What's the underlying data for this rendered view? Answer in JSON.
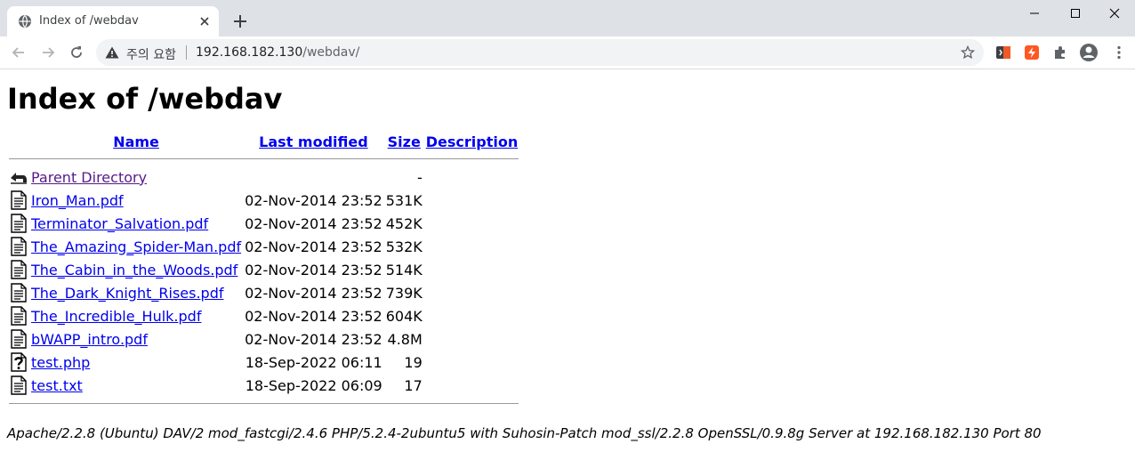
{
  "browser": {
    "tab_title": "Index of /webdav",
    "warning_text": "주의 요함",
    "url_host": "192.168.182.130",
    "url_path": "/webdav/"
  },
  "page": {
    "heading": "Index of /webdav",
    "columns": {
      "name": "Name",
      "modified": "Last modified",
      "size": "Size",
      "description": "Description"
    },
    "parent": {
      "name": "Parent Directory",
      "size": "-"
    },
    "files": [
      {
        "name": "Iron_Man.pdf",
        "modified": "02-Nov-2014 23:52",
        "size": "531K",
        "icon": "document-icon"
      },
      {
        "name": "Terminator_Salvation.pdf",
        "modified": "02-Nov-2014 23:52",
        "size": "452K",
        "icon": "document-icon"
      },
      {
        "name": "The_Amazing_Spider-Man.pdf",
        "modified": "02-Nov-2014 23:52",
        "size": "532K",
        "icon": "document-icon"
      },
      {
        "name": "The_Cabin_in_the_Woods.pdf",
        "modified": "02-Nov-2014 23:52",
        "size": "514K",
        "icon": "document-icon"
      },
      {
        "name": "The_Dark_Knight_Rises.pdf",
        "modified": "02-Nov-2014 23:52",
        "size": "739K",
        "icon": "document-icon"
      },
      {
        "name": "The_Incredible_Hulk.pdf",
        "modified": "02-Nov-2014 23:52",
        "size": "604K",
        "icon": "document-icon"
      },
      {
        "name": "bWAPP_intro.pdf",
        "modified": "02-Nov-2014 23:52",
        "size": "4.8M",
        "icon": "document-icon"
      },
      {
        "name": "test.php",
        "modified": "18-Sep-2022 06:11",
        "size": "19",
        "icon": "unknown-file-icon"
      },
      {
        "name": "test.txt",
        "modified": "18-Sep-2022 06:09",
        "size": "17",
        "icon": "document-icon"
      }
    ],
    "footer": "Apache/2.2.8 (Ubuntu) DAV/2 mod_fastcgi/2.4.6 PHP/5.2.4-2ubuntu5 with Suhosin-Patch mod_ssl/2.2.8 OpenSSL/0.9.8g Server at 192.168.182.130 Port 80"
  },
  "colors": {
    "link": "#0000ee",
    "visited_link": "#551a8b",
    "tabbar_bg": "#dee1e6",
    "omnibox_bg": "#f1f3f4"
  }
}
